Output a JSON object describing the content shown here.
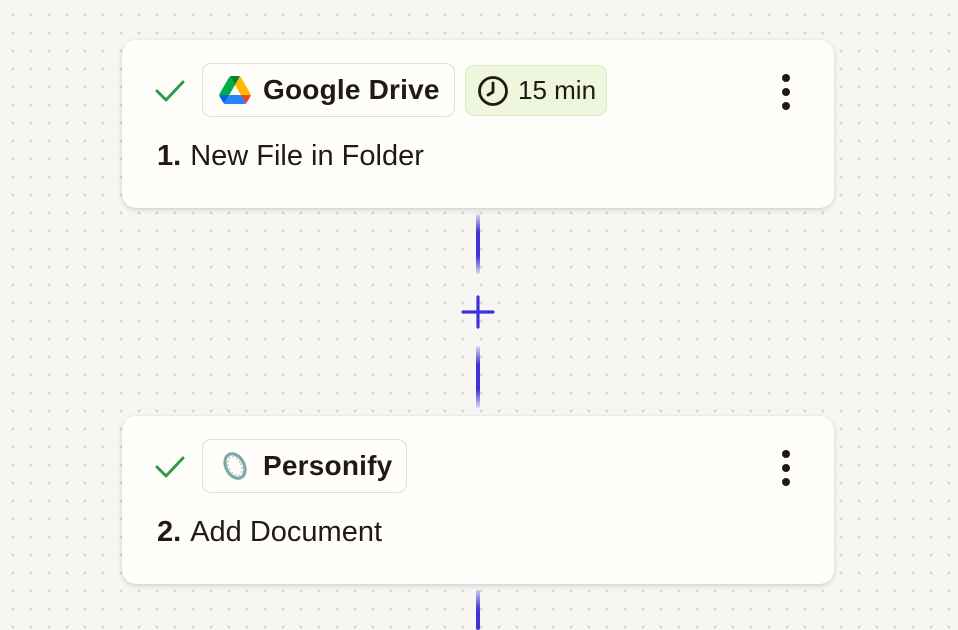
{
  "steps": [
    {
      "status": "complete",
      "app": {
        "name": "Google Drive",
        "icon": "google-drive-icon"
      },
      "poll_interval": "15 min",
      "number": "1.",
      "title": "New File in Folder"
    },
    {
      "status": "complete",
      "app": {
        "name": "Personify",
        "icon": "personify-icon"
      },
      "number": "2.",
      "title": "Add Document"
    }
  ],
  "colors": {
    "connector": "#3f33d8",
    "check": "#2e9a4a",
    "time_chip_bg": "#eef7dc",
    "canvas_bg": "#f7f6f3",
    "card_bg": "#fffefb"
  }
}
